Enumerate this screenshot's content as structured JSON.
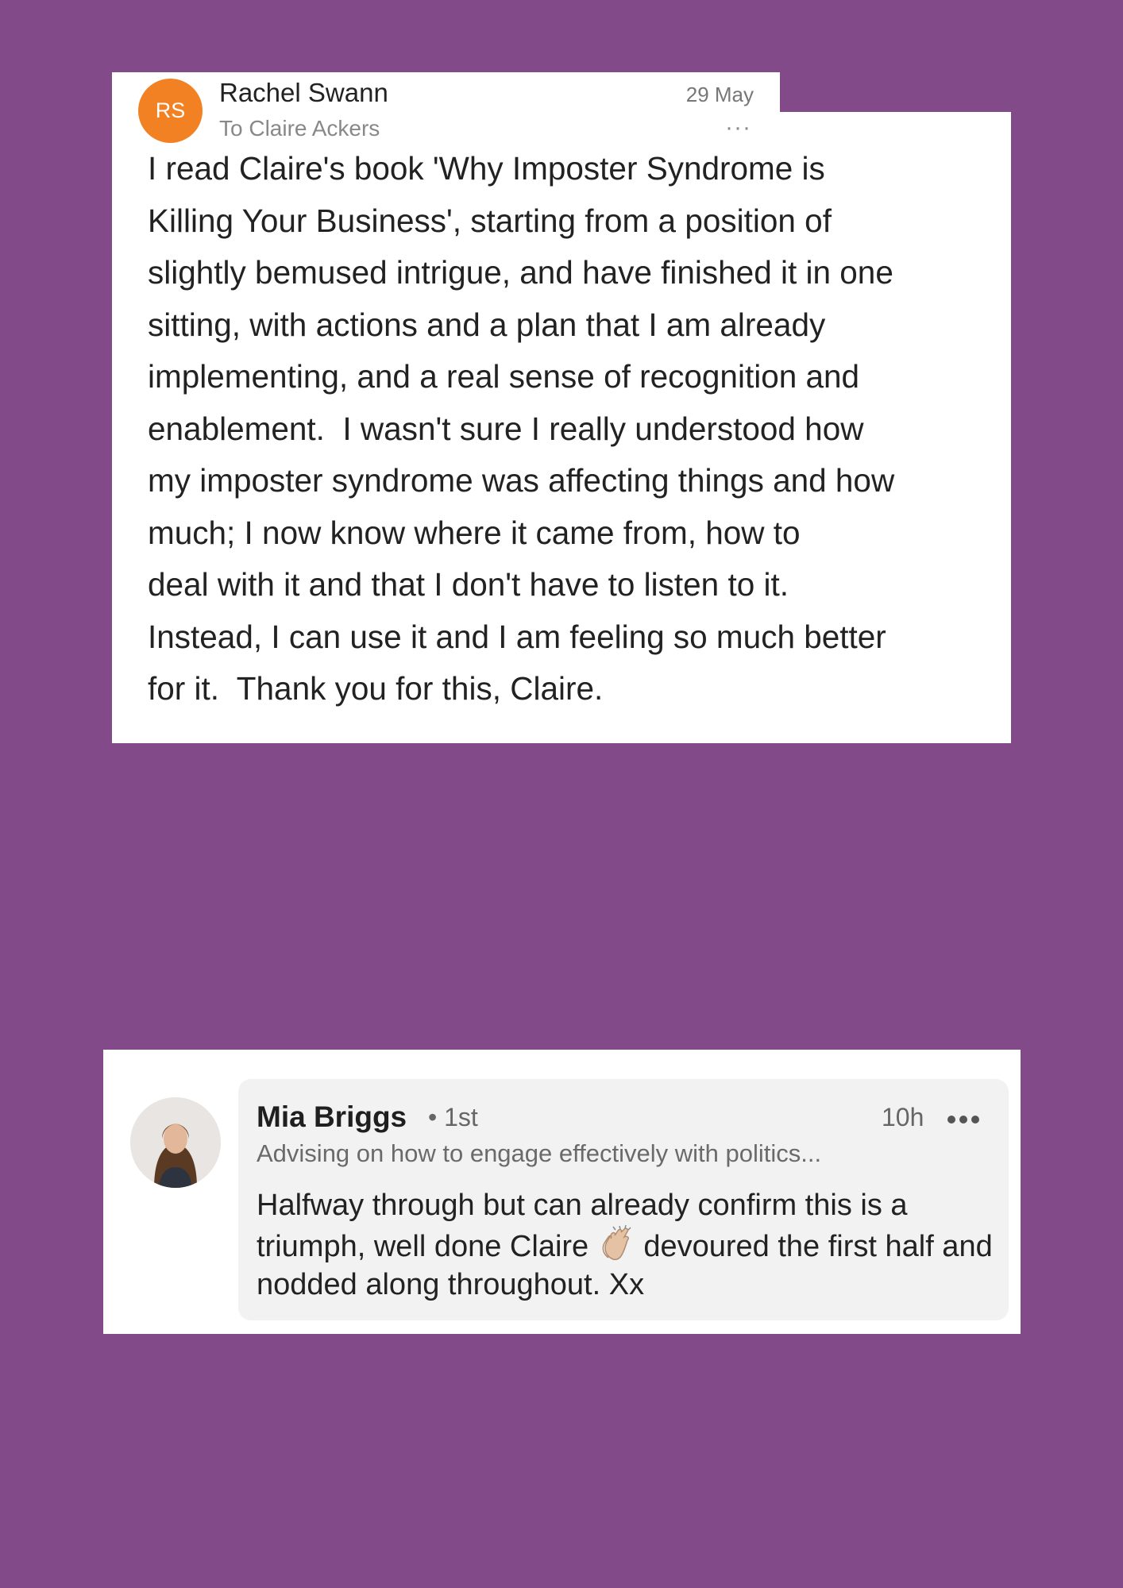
{
  "email": {
    "avatar_initials": "RS",
    "avatar_color": "#f28123",
    "sender": "Rachel Swann",
    "recipient": "To Claire Ackers",
    "date": "29 May",
    "more": "···",
    "body_lines": [
      "I read Claire's book 'Why Imposter Syndrome is",
      "Killing Your Business', starting from a position of",
      "slightly bemused intrigue, and have finished it in one",
      "sitting, with actions and a plan that I am already",
      "implementing, and a real sense of recognition and",
      "enablement.  I wasn't sure I really understood how",
      "my imposter syndrome was affecting things and how",
      "much; I now know where it came from, how to",
      "deal with it and that I don't have to listen to it.",
      "Instead, I can use it and I am feeling so much better",
      "for it.  Thank you for this, Claire."
    ]
  },
  "comment": {
    "name": "Mia Briggs",
    "degree": "• 1st",
    "time": "10h",
    "headline": "Advising on how to engage effectively with politics...",
    "text_before_emoji": "Halfway through but can already confirm this is a triumph, well done Claire",
    "emoji": "clapping-hands-icon",
    "text_after_emoji": " devoured the first half and nodded along throughout. Xx"
  },
  "colors": {
    "background": "#834a8a",
    "card": "#ffffff",
    "bubble": "#f2f2f2"
  }
}
